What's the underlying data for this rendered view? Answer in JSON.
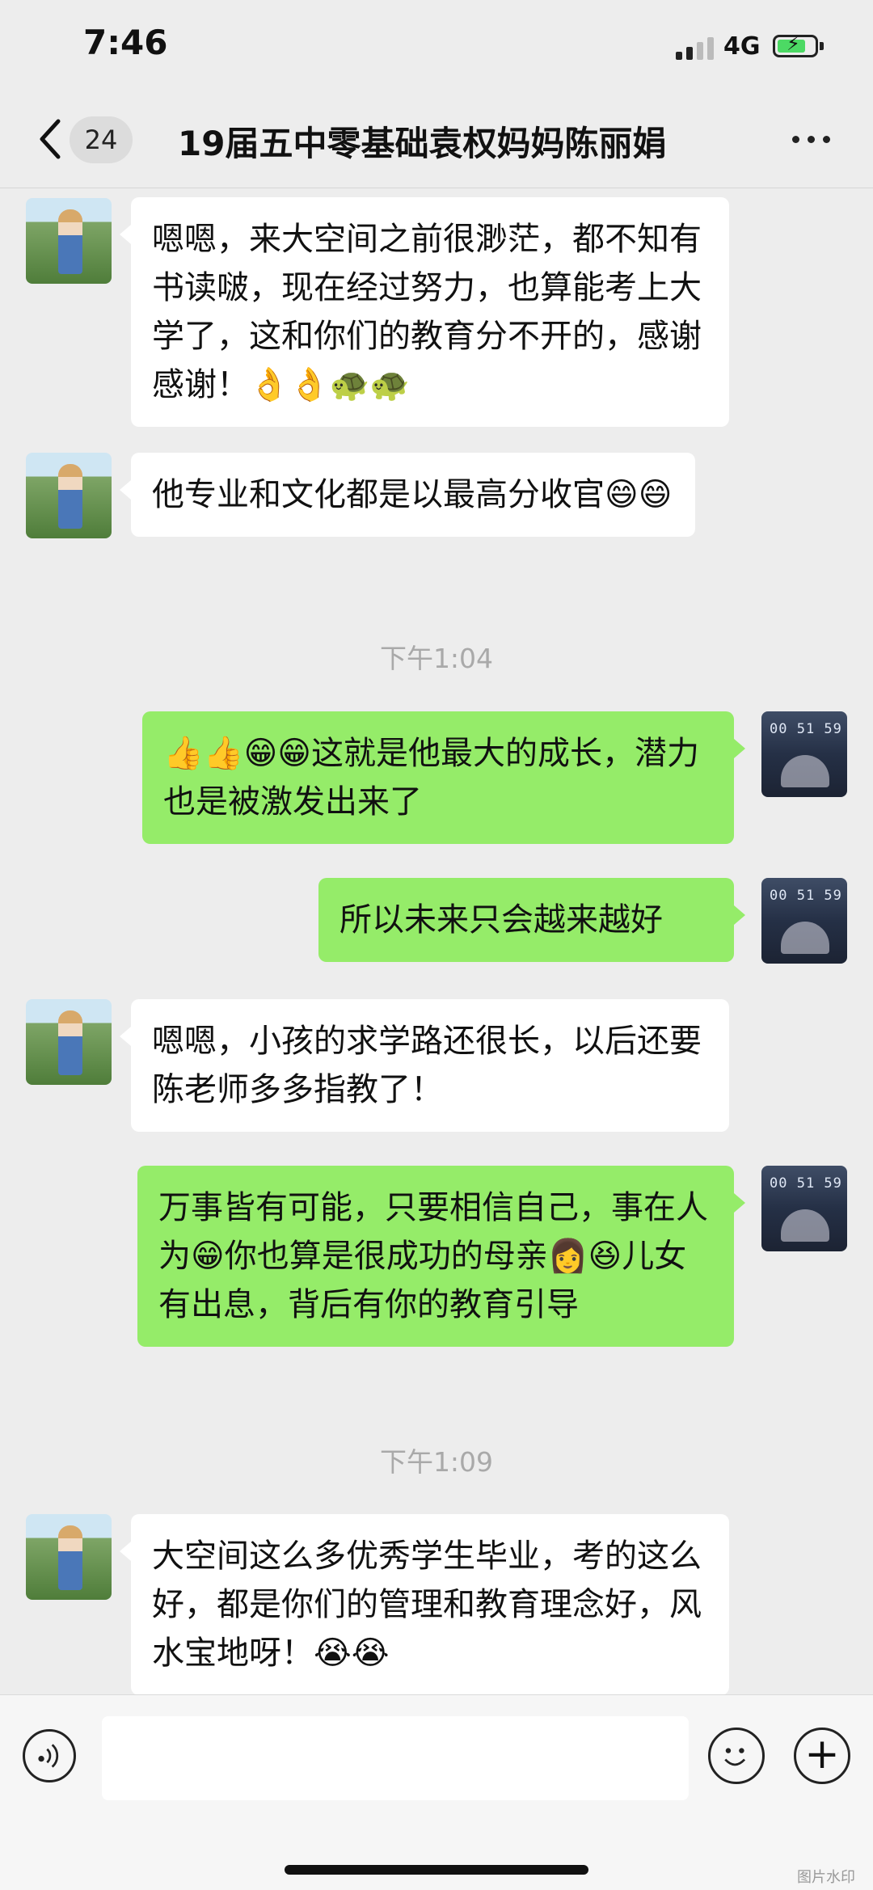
{
  "status_bar": {
    "time": "7:46",
    "network": "4G",
    "icons": [
      "signal-icon",
      "battery-charging-icon"
    ]
  },
  "nav": {
    "back_badge": "24",
    "title": "19届五中零基础袁权妈妈陈丽娟",
    "icons": [
      "back-chevron-icon",
      "more-dots-icon"
    ]
  },
  "messages": [
    {
      "side": "left",
      "text": "嗯嗯，来大空间之前很渺茫，都不知有书读啵，现在经过努力，也算能考上大学了，这和你们的教育分不开的，感谢感谢！👌👌🐢🐢"
    },
    {
      "side": "left",
      "text": "他专业和文化都是以最高分收官😄😄"
    },
    {
      "type": "time",
      "text": "下午1:04"
    },
    {
      "side": "right",
      "text": "👍👍😁😁这就是他最大的成长，潜力也是被激发出来了"
    },
    {
      "side": "right",
      "text": "所以未来只会越来越好"
    },
    {
      "side": "left",
      "text": "嗯嗯，小孩的求学路还很长，以后还要陈老师多多指教了！"
    },
    {
      "side": "right",
      "text": "万事皆有可能，只要相信自己，事在人为😁你也算是很成功的母亲👩😆儿女有出息，背后有你的教育引导"
    },
    {
      "type": "time",
      "text": "下午1:09"
    },
    {
      "side": "left",
      "text": "大空间这么多优秀学生毕业，考的这么好，都是你们的管理和教育理念好，风水宝地呀！😭😭"
    }
  ],
  "avatar_right": {
    "clock_text": "00 51 59"
  },
  "input_bar": {
    "icons": [
      "voice-icon",
      "emoji-icon",
      "plus-icon"
    ]
  },
  "watermark": "图片水印",
  "colors": {
    "background": "#ededed",
    "sent_bubble": "#95ec69",
    "received_bubble": "#ffffff",
    "timestamp": "#a9a9a9"
  }
}
